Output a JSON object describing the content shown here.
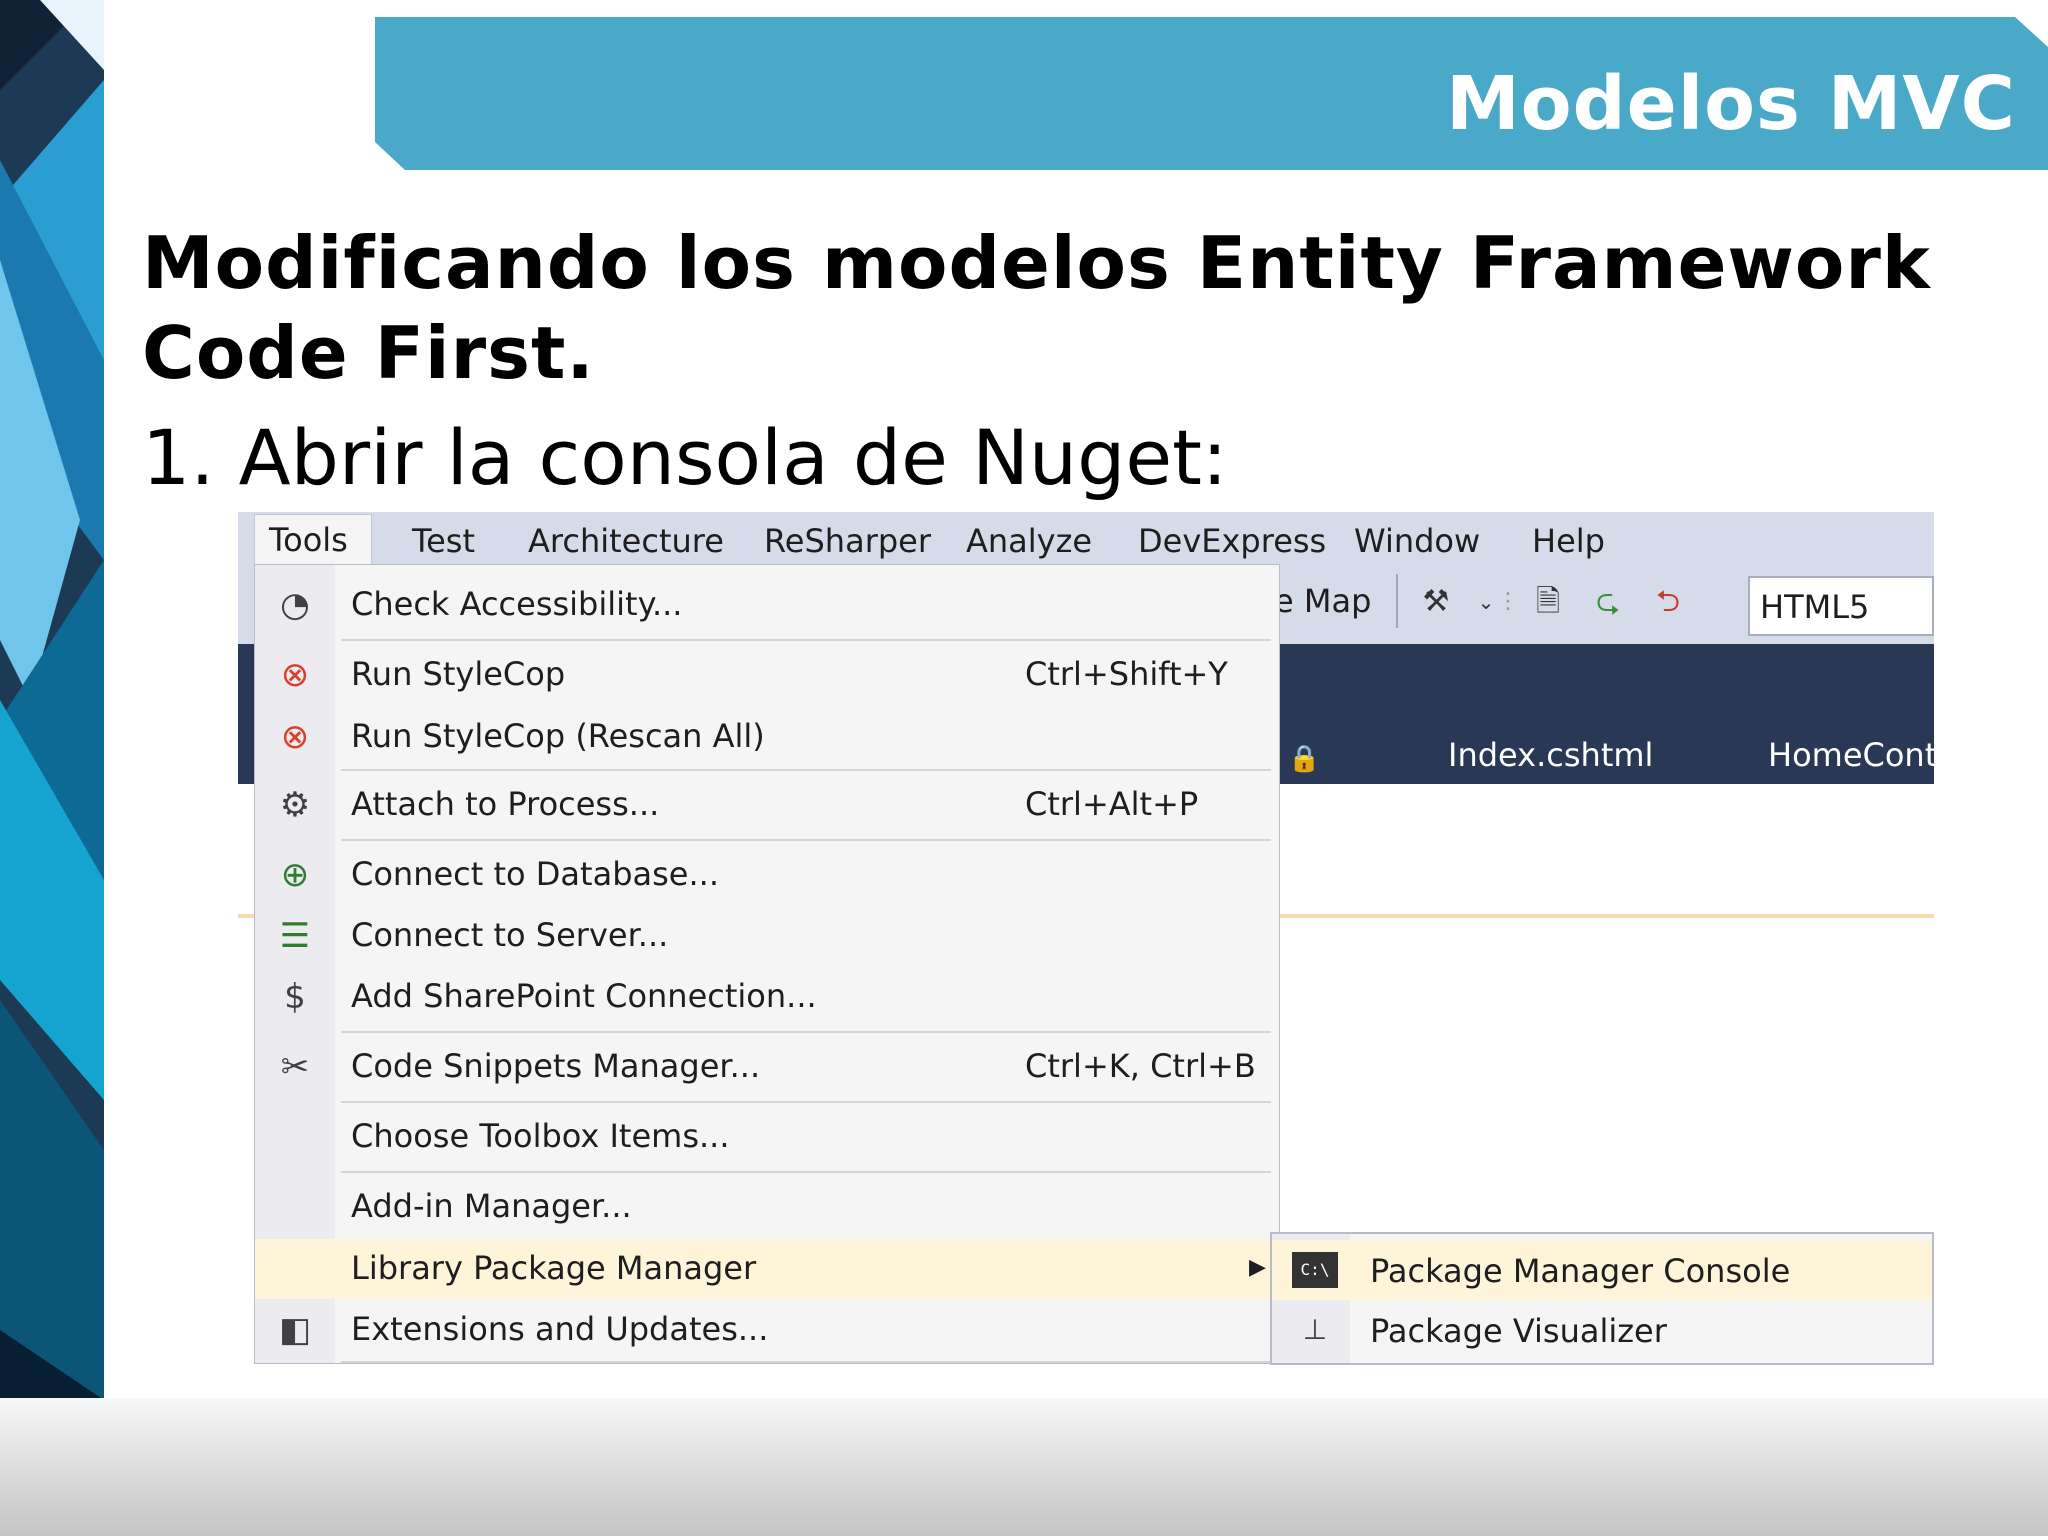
{
  "slide": {
    "title": "Modelos MVC",
    "subtitle": "Modificando los modelos Entity Framework Code First.",
    "step": "1. Abrir la consola de Nuget:"
  },
  "colors": {
    "banner": "#4aa9c8",
    "menu_highlight": "#fdf4d9",
    "tab_bar": "#293955",
    "menu_bg": "#f5f5f5"
  },
  "menubar": {
    "items": [
      "Tools",
      "Test",
      "Architecture",
      "ReSharper",
      "Analyze",
      "DevExpress",
      "Window",
      "Help"
    ]
  },
  "toolbar": {
    "map_label": "e Map",
    "schema_value": "HTML5"
  },
  "tabs": {
    "index": "Index.cshtml",
    "homecont": "HomeCont"
  },
  "tools_menu": {
    "items": [
      {
        "label": "Check Accessibility...",
        "shortcut": "",
        "icon": "accessibility-icon"
      },
      {
        "label": "Run StyleCop",
        "shortcut": "Ctrl+Shift+Y",
        "icon": "stylecop-icon"
      },
      {
        "label": "Run StyleCop (Rescan All)",
        "shortcut": "",
        "icon": "stylecop-icon"
      },
      {
        "label": "Attach to Process...",
        "shortcut": "Ctrl+Alt+P",
        "icon": "gears-icon"
      },
      {
        "label": "Connect to Database...",
        "shortcut": "",
        "icon": "database-connect-icon"
      },
      {
        "label": "Connect to Server...",
        "shortcut": "",
        "icon": "server-connect-icon"
      },
      {
        "label": "Add SharePoint Connection...",
        "shortcut": "",
        "icon": "sharepoint-icon"
      },
      {
        "label": "Code Snippets Manager...",
        "shortcut": "Ctrl+K, Ctrl+B",
        "icon": "snippets-icon"
      },
      {
        "label": "Choose Toolbox Items...",
        "shortcut": "",
        "icon": ""
      },
      {
        "label": "Add-in Manager...",
        "shortcut": "",
        "icon": ""
      },
      {
        "label": "Library Package Manager",
        "shortcut": "",
        "icon": ""
      },
      {
        "label": "Extensions and Updates...",
        "shortcut": "",
        "icon": "extensions-icon"
      }
    ]
  },
  "submenu": {
    "items": [
      {
        "label": "Package Manager Console",
        "icon": "console-icon"
      },
      {
        "label": "Package Visualizer",
        "icon": "hierarchy-icon"
      }
    ]
  }
}
